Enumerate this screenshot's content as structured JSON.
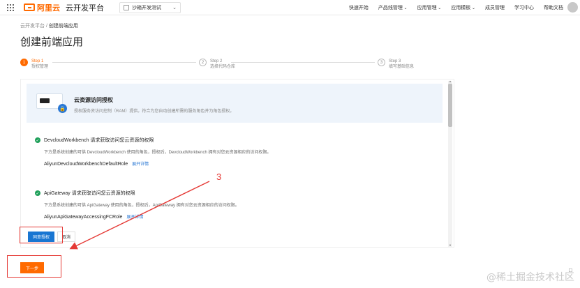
{
  "topbar": {
    "logo_text": "阿里云",
    "app_title": "云开发平台",
    "env_select_value": "沙箱开发测试",
    "nav": [
      "快速开始",
      "产品线管理",
      "应用管理",
      "应用模板",
      "成员管理",
      "学习中心",
      "帮助文档"
    ],
    "avatar_text": "avatar"
  },
  "breadcrumb": {
    "root": "云开发平台",
    "separator": "/",
    "current": "创建前端应用"
  },
  "page_title": "创建前端应用",
  "steps": [
    {
      "num": "1",
      "name": "Step 1",
      "desc": "授权管理"
    },
    {
      "num": "2",
      "name": "Step 2",
      "desc": "选择代码仓库"
    },
    {
      "num": "3",
      "name": "Step 3",
      "desc": "填写基础信息"
    }
  ],
  "banner": {
    "title": "云资源访问授权",
    "desc": "授权服务资访问控制（RAM）提供。符合为您自动创建所需的服务角色并为角色授权。"
  },
  "permissions": [
    {
      "title": "DevcloudWorkbench 请求获取访问您云资源的权限",
      "desc": "下方是系统创建的可供 DevcloudWorkbench 使用的角色，授权后，DevcloudWorkbench 拥有对您云资源相应的访问权限。",
      "role": "AliyunDevcloudWorkbenchDefaultRole",
      "link": "展开详情"
    },
    {
      "title": "ApiGateway 请求获取访问您云资源的权限",
      "desc": "下方是系统创建的可供 ApiGateway 使用的角色，授权后，ApiGateway 拥有对您云资源相应的访问权限。",
      "role": "AliyunApiGatewayAccessingFCRole",
      "link": "展开详情"
    }
  ],
  "buttons": {
    "agree": "同意授权",
    "cancel": "取消",
    "next": "下一步"
  },
  "annotation": {
    "number": "3"
  },
  "watermark": "@稀土掘金技术社区",
  "colors": {
    "brand": "#ff6a00",
    "primary": "#1976d2",
    "annotation": "#e53935",
    "success": "#1fa05a"
  }
}
